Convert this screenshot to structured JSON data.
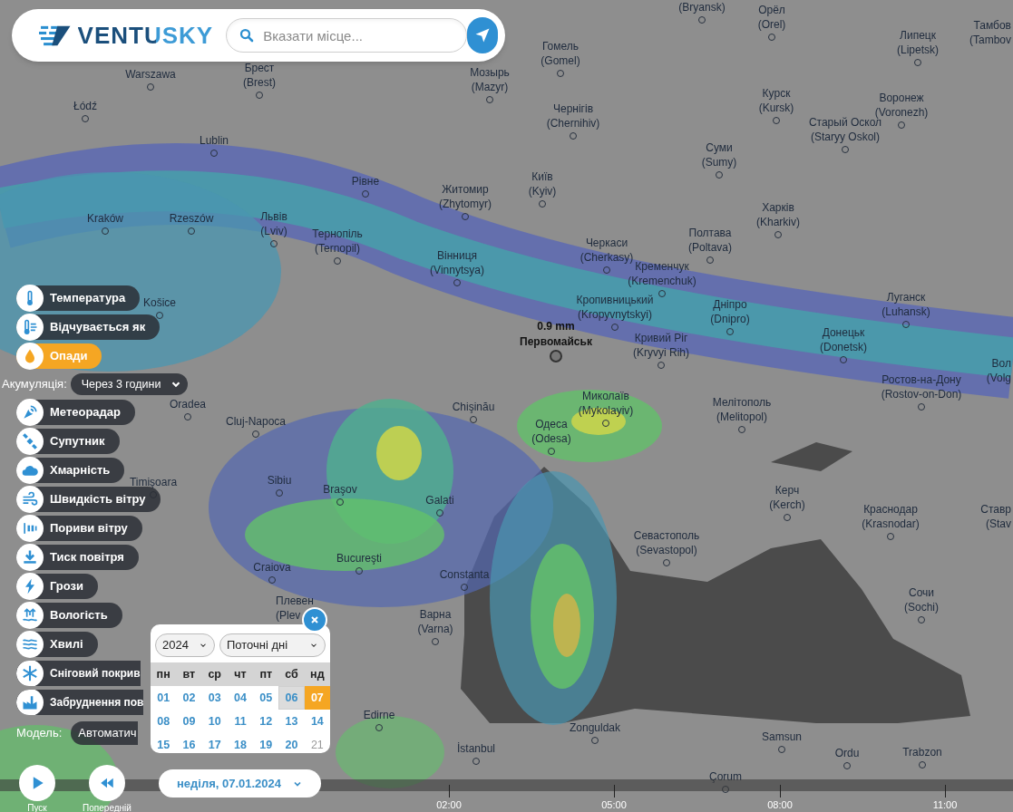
{
  "header": {
    "logo": "VENTUSKY",
    "search": {
      "placeholder": "Вказати місце..."
    }
  },
  "layers": [
    {
      "label": "Температура",
      "selected": false
    },
    {
      "label": "Відчувається як",
      "selected": false
    },
    {
      "label": "Опади",
      "selected": true,
      "setting": {
        "label": "Акумуляція:",
        "value": "Через 3 години"
      }
    },
    {
      "label": "Метеорадар",
      "selected": false
    },
    {
      "label": "Супутник",
      "selected": false
    },
    {
      "label": "Хмарність",
      "selected": false
    },
    {
      "label": "Швидкість вітру",
      "selected": false
    },
    {
      "label": "Пориви вітру",
      "selected": false
    },
    {
      "label": "Тиск повітря",
      "selected": false
    },
    {
      "label": "Грози",
      "selected": false
    },
    {
      "label": "Вологість",
      "selected": false
    },
    {
      "label": "Хвилі",
      "selected": false
    },
    {
      "label": "Сніговий покрив",
      "selected": false
    },
    {
      "label": "Забруднення пов",
      "selected": false
    }
  ],
  "model": {
    "label": "Модель:",
    "value": "Автоматич"
  },
  "marker": {
    "value": "0.9 mm",
    "place": "Первомайськ"
  },
  "cities": [
    {
      "name": "Warszawa"
    },
    {
      "name": "Łódź"
    },
    {
      "name": "Lublin"
    },
    {
      "name": "Брест",
      "alt": "(Brest)"
    },
    {
      "name": "Мозырь",
      "alt": "(Mazyr)"
    },
    {
      "name": "Kraków"
    },
    {
      "name": "Rzeszów"
    },
    {
      "name": "Львів",
      "alt": "(Lviv)"
    },
    {
      "name": "Рівне"
    },
    {
      "name": "Житомир",
      "alt": "(Zhytomyr)"
    },
    {
      "name": "Тернопіль",
      "alt": "(Ternopil)"
    },
    {
      "name": "Вінниця",
      "alt": "(Vinnytsya)"
    },
    {
      "name": "(Bryansk)"
    },
    {
      "name": "Орёл",
      "alt": "(Orel)"
    },
    {
      "name": "Тамбов",
      "alt": "(Tambov"
    },
    {
      "name": "Гомель",
      "alt": "(Gomel)"
    },
    {
      "name": "Липецк",
      "alt": "(Lipetsk)"
    },
    {
      "name": "Чернігів",
      "alt": "(Chernihiv)"
    },
    {
      "name": "Курск",
      "alt": "(Kursk)"
    },
    {
      "name": "Воронеж",
      "alt": "(Voronezh)"
    },
    {
      "name": "Старый Оскол",
      "alt": "(Staryy Oskol)"
    },
    {
      "name": "Суми",
      "alt": "(Sumy)"
    },
    {
      "name": "Київ",
      "alt": "(Kyiv)"
    },
    {
      "name": "Харків",
      "alt": "(Kharkiv)"
    },
    {
      "name": "Полтава",
      "alt": "(Poltava)"
    },
    {
      "name": "Черкаси",
      "alt": "(Cherkasy)"
    },
    {
      "name": "Кременчук",
      "alt": "(Kremenchuk)"
    },
    {
      "name": "Кропивницький",
      "alt": "(Kropyvnytskyi)"
    },
    {
      "name": "Дніпро",
      "alt": "(Dnipro)"
    },
    {
      "name": "Луганск",
      "alt": "(Luhansk)"
    },
    {
      "name": "Кривий Ріг",
      "alt": "(Kryvyi Rih)"
    },
    {
      "name": "Донецьк",
      "alt": "(Donetsk)"
    },
    {
      "name": "Вол",
      "alt": "(Volg"
    },
    {
      "name": "Ростов-на-Дону",
      "alt": "(Rostov-on-Don)"
    },
    {
      "name": "Миколаїв",
      "alt": "(Mykolayiv)"
    },
    {
      "name": "Мелітополь",
      "alt": "(Melitopol)"
    },
    {
      "name": "Košice"
    },
    {
      "name": "Oradea"
    },
    {
      "name": "Cluj-Napoca"
    },
    {
      "name": "Chişinău"
    },
    {
      "name": "Одеса",
      "alt": "(Odesa)"
    },
    {
      "name": "Timişoara"
    },
    {
      "name": "Sibiu"
    },
    {
      "name": "Braşov"
    },
    {
      "name": "Galati"
    },
    {
      "name": "Керч",
      "alt": "(Kerch)"
    },
    {
      "name": "Краснодар",
      "alt": "(Krasnodar)"
    },
    {
      "name": "Ставр",
      "alt": "(Stav"
    },
    {
      "name": "Севастополь",
      "alt": "(Sevastopol)"
    },
    {
      "name": "Craiova"
    },
    {
      "name": "Bucureşti"
    },
    {
      "name": "Constanta"
    },
    {
      "name": "Плевен",
      "alt": "(Plev"
    },
    {
      "name": "Варна",
      "alt": "(Varna)"
    },
    {
      "name": "Сочи",
      "alt": "(Sochi)"
    },
    {
      "name": "Edirne"
    },
    {
      "name": "Zonguldak"
    },
    {
      "name": "Samsun"
    },
    {
      "name": "İstanbul"
    },
    {
      "name": "Ordu"
    },
    {
      "name": "Trabzon"
    },
    {
      "name": "Çorum"
    }
  ],
  "calendar": {
    "year": "2024",
    "range": "Поточні дні",
    "weekdays": [
      "пн",
      "вт",
      "ср",
      "чт",
      "пт",
      "сб",
      "нд"
    ],
    "days": [
      {
        "day": "01",
        "selected": false,
        "shaded": false,
        "disabled": false
      },
      {
        "day": "02",
        "selected": false,
        "shaded": false,
        "disabled": false
      },
      {
        "day": "03",
        "selected": false,
        "shaded": false,
        "disabled": false
      },
      {
        "day": "04",
        "selected": false,
        "shaded": false,
        "disabled": false
      },
      {
        "day": "05",
        "selected": false,
        "shaded": false,
        "disabled": false
      },
      {
        "day": "06",
        "selected": false,
        "shaded": true,
        "disabled": false
      },
      {
        "day": "07",
        "selected": true,
        "shaded": false,
        "disabled": false
      },
      {
        "day": "08",
        "selected": false,
        "shaded": false,
        "disabled": false
      },
      {
        "day": "09",
        "selected": false,
        "shaded": false,
        "disabled": false
      },
      {
        "day": "10",
        "selected": false,
        "shaded": false,
        "disabled": false
      },
      {
        "day": "11",
        "selected": false,
        "shaded": false,
        "disabled": false
      },
      {
        "day": "12",
        "selected": false,
        "shaded": false,
        "disabled": false
      },
      {
        "day": "13",
        "selected": false,
        "shaded": false,
        "disabled": false
      },
      {
        "day": "14",
        "selected": false,
        "shaded": false,
        "disabled": false
      },
      {
        "day": "15",
        "selected": false,
        "shaded": false,
        "disabled": false
      },
      {
        "day": "16",
        "selected": false,
        "shaded": false,
        "disabled": false
      },
      {
        "day": "17",
        "selected": false,
        "shaded": false,
        "disabled": false
      },
      {
        "day": "18",
        "selected": false,
        "shaded": false,
        "disabled": false
      },
      {
        "day": "19",
        "selected": false,
        "shaded": false,
        "disabled": false
      },
      {
        "day": "20",
        "selected": false,
        "shaded": false,
        "disabled": false
      },
      {
        "day": "21",
        "selected": false,
        "shaded": false,
        "disabled": true
      }
    ]
  },
  "playback": {
    "play_label": "Пуск",
    "previous_label": "Попередній",
    "date": "неділя, 07.01.2024"
  },
  "timeline": {
    "ticks": [
      "02:00",
      "05:00",
      "08:00",
      "11:00"
    ]
  }
}
